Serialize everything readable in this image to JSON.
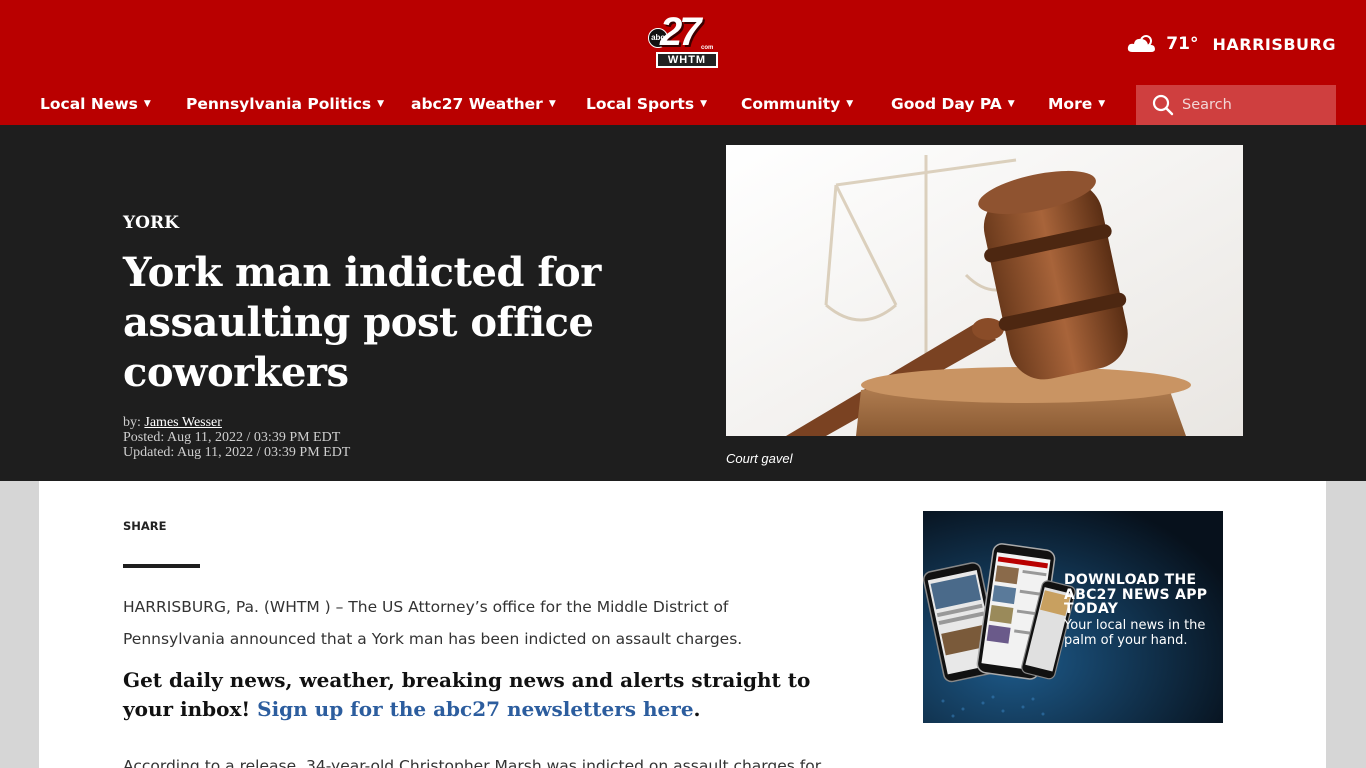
{
  "header": {
    "logo": {
      "number": "27",
      "network": "abc",
      "domain": "com",
      "call_letters": "WHTM"
    },
    "weather": {
      "icon": "cloud-sun-icon",
      "temperature": "71°",
      "city": "HARRISBURG"
    }
  },
  "nav": {
    "items": [
      {
        "label": "Local News",
        "caret": "▼"
      },
      {
        "label": "Pennsylvania Politics",
        "caret": "▼"
      },
      {
        "label": "abc27 Weather",
        "caret": "▼"
      },
      {
        "label": "Local Sports",
        "caret": "▼"
      },
      {
        "label": "Community",
        "caret": "▼"
      },
      {
        "label": "Good Day PA",
        "caret": "▼"
      },
      {
        "label": "More",
        "caret": "▼"
      }
    ],
    "search": {
      "placeholder": "Search",
      "icon": "search-icon"
    }
  },
  "article": {
    "kicker": "YORK",
    "headline": "York man indicted for assaulting post office coworkers",
    "byline_prefix": "by: ",
    "author": "James Wesser",
    "posted": "Posted: Aug 11, 2022 / 03:39 PM EDT",
    "updated": "Updated: Aug 11, 2022 / 03:39 PM EDT",
    "image_caption": "Court gavel",
    "share_label": "SHARE",
    "lede": "HARRISBURG, Pa. (WHTM ) –  The US Attorney’s office for the Middle District of Pennsylvania announced that a York man has been indicted on assault charges.",
    "promo_text": "Get daily news, weather, breaking news and alerts straight to your inbox! ",
    "promo_link": "Sign up for the abc27 newsletters here",
    "promo_end": ".",
    "next_paragraph": "According to a release, 34-year-old Christopher Marsh was indicted on assault charges for"
  },
  "ad": {
    "title": "DOWNLOAD THE ABC27 NEWS APP TODAY",
    "subtitle": "Your local news in the palm of your hand."
  },
  "colors": {
    "brand_red": "#b90000",
    "search_bg": "#cf3f3f",
    "hero_bg": "#1e1e1e",
    "link_blue": "#2c5d9e"
  }
}
